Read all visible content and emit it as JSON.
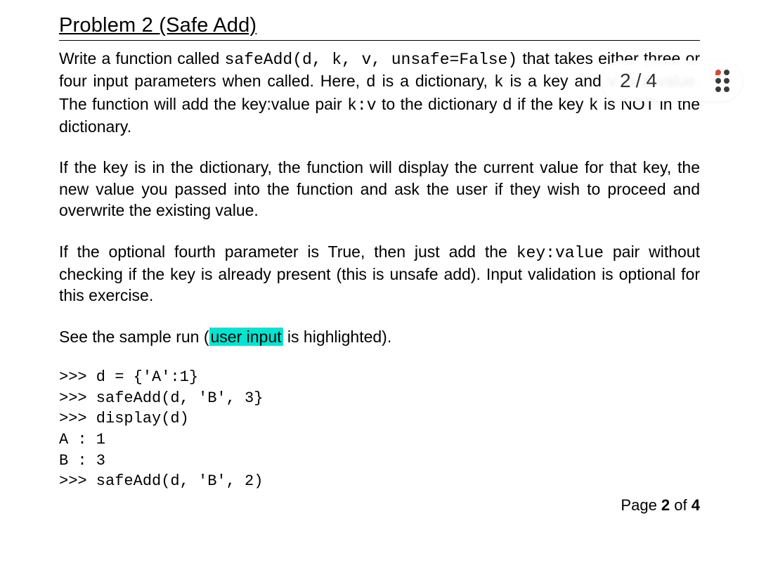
{
  "heading": "Problem 2 (Safe Add)",
  "para1": {
    "t1": "Write a function called ",
    "code1": "safeAdd(d, k, v, unsafe=False)",
    "t2": " that takes either three or four input parameters when called. Here, ",
    "code2": "d",
    "t3": "  is a dictionary, ",
    "code3": "k",
    "t4": " is a key and ",
    "code4": "v",
    "t5": " is a value. The function will add the key:value pair  ",
    "code5": "k:v",
    "t6": "  to the dictionary ",
    "code6": "d",
    "t7": " if the key ",
    "code7": "k",
    "t8": " is NOT in the dictionary."
  },
  "para2": "If the key is in the dictionary, the function will display the current value for that key, the new value you passed into the function and ask the user if they wish to proceed and overwrite the existing value.",
  "para3": {
    "t1": "If the optional fourth parameter is True, then just add the ",
    "code1": "key:value",
    "t2": " pair without checking if the key is already present (this is unsafe add). Input validation is optional for this exercise."
  },
  "para4": {
    "t1": "See the sample run (",
    "hl": "user input",
    "t2": " is highlighted)."
  },
  "code_lines": {
    "l1": ">>> d = {'A':1}",
    "l2": ">>> safeAdd(d, 'B', 3}",
    "l3": ">>> display(d)",
    "l4": "A : 1",
    "l5": "B : 3",
    "l6": ">>> safeAdd(d, 'B', 2)"
  },
  "footer": {
    "prefix": "Page ",
    "current": "2",
    "of": " of ",
    "total": "4"
  },
  "indicator": {
    "current": "2",
    "total": "4"
  }
}
